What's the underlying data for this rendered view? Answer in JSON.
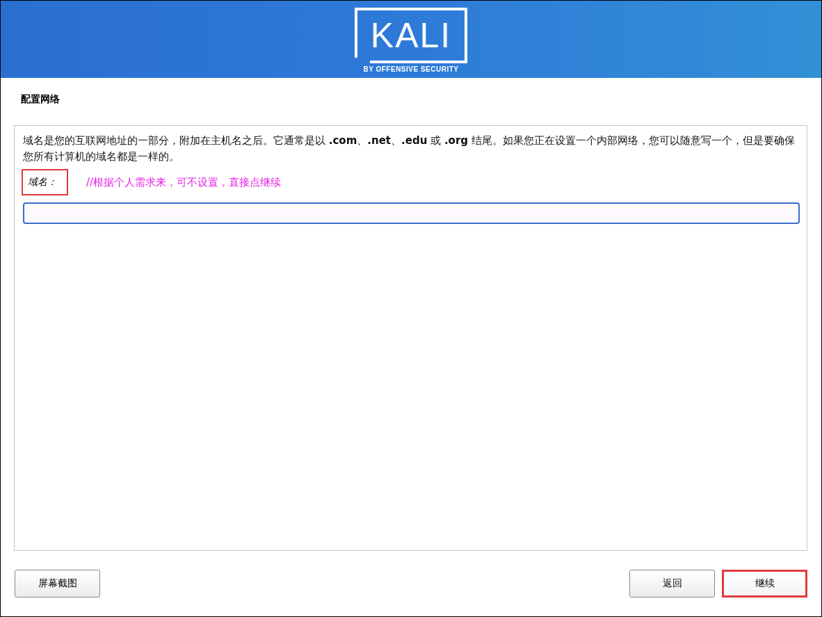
{
  "header": {
    "logo_text": "KALI",
    "tagline": "BY OFFENSIVE SECURITY"
  },
  "page_title": "配置网络",
  "description": "域名是您的互联网地址的一部分，附加在主机名之后。它通常是以 **.com**、**.net**、**.edu** 或 **.org** 结尾。如果您正在设置一个内部网络，您可以随意写一个，但是要确保您所有计算机的域名都是一样的。",
  "field": {
    "label": "域名：",
    "label_highlighted": true,
    "annotation": "//根据个人需求来，可不设置，直接点继续"
  },
  "buttons": [
    {
      "label": "屏幕截图",
      "kind": "left",
      "highlighted": false
    },
    {
      "label": "返回",
      "kind": "right",
      "highlighted": false
    },
    {
      "label": "继续",
      "kind": "right",
      "highlighted": true
    }
  ]
}
